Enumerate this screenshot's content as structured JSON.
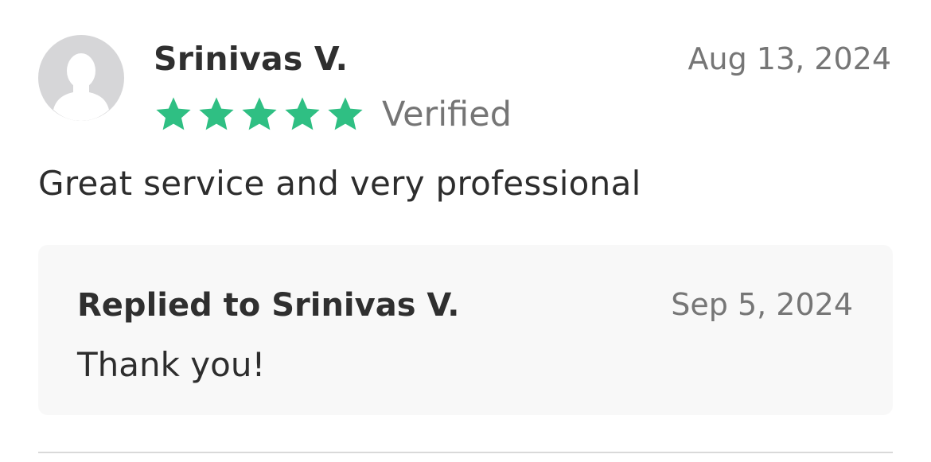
{
  "review": {
    "avatar_icon": "default-user-silhouette-icon",
    "reviewer_name": "Srinivas V.",
    "date": "Aug 13, 2024",
    "rating": 5,
    "rating_max": 5,
    "star_icon": "star-icon",
    "verified_label": "Verified",
    "body": "Great service and very professional"
  },
  "reply": {
    "title": "Replied to Srinivas V.",
    "date": "Sep 5, 2024",
    "body": "Thank you!"
  },
  "colors": {
    "star": "#2fbf83",
    "avatar_bg": "#d6d6d8",
    "avatar_fg": "#ffffff",
    "reply_bg": "#f8f8f8",
    "muted_text": "#767676",
    "divider": "#d9d9d9"
  }
}
